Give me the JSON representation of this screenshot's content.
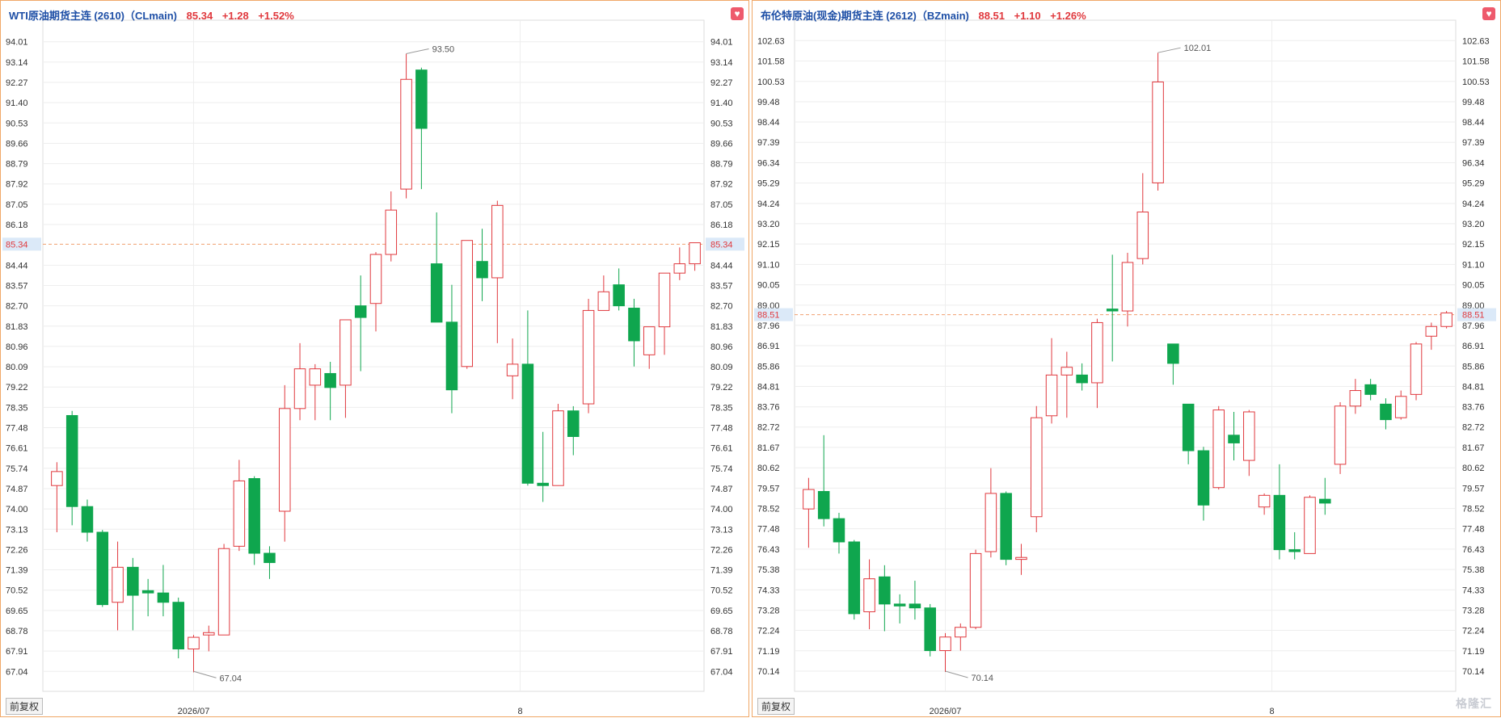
{
  "left": {
    "title": "WTI原油期货主连 (2610)（CLmain)",
    "price": "85.34",
    "change": "+1.28",
    "percent": "+1.52%",
    "adjust_button": "前复权"
  },
  "right": {
    "title": "布伦特原油(现金)期货主连 (2612)（BZmain)",
    "price": "88.51",
    "change": "+1.10",
    "percent": "+1.26%",
    "adjust_button": "前复权",
    "watermark": "格隆汇"
  },
  "colors": {
    "up": "#e0393e",
    "down": "#0fa64e",
    "accent": "#1e4fa6",
    "current_line": "#f0a070"
  },
  "chart_data": [
    {
      "type": "candlestick",
      "symbol": "CLmain",
      "y_ticks": [
        "94.01",
        "93.14",
        "92.27",
        "91.40",
        "90.53",
        "89.66",
        "88.79",
        "87.92",
        "87.05",
        "86.18",
        "85.34",
        "84.44",
        "83.57",
        "82.70",
        "81.83",
        "80.96",
        "80.09",
        "79.22",
        "78.35",
        "77.48",
        "76.61",
        "75.74",
        "74.87",
        "74.00",
        "73.13",
        "72.26",
        "71.39",
        "70.52",
        "69.65",
        "68.78",
        "67.91",
        "67.04"
      ],
      "ylim": [
        66.6,
        94.45
      ],
      "x_labels": [
        {
          "label": "2026/07",
          "index": 9
        },
        {
          "label": "8",
          "index": 30.5
        }
      ],
      "current": 85.34,
      "high_label": {
        "text": "93.50",
        "value": 93.5,
        "index": 23
      },
      "low_label": {
        "text": "67.04",
        "value": 67.04,
        "index": 9
      },
      "ohlc": [
        [
          75.0,
          76.0,
          73.0,
          75.6
        ],
        [
          78.0,
          78.2,
          73.3,
          74.1
        ],
        [
          74.1,
          74.4,
          72.6,
          73.0
        ],
        [
          73.0,
          73.1,
          69.8,
          69.9
        ],
        [
          70.0,
          72.6,
          68.8,
          71.5
        ],
        [
          71.5,
          71.9,
          68.8,
          70.3
        ],
        [
          70.5,
          71.0,
          69.4,
          70.4
        ],
        [
          70.4,
          71.6,
          69.4,
          70.0
        ],
        [
          70.0,
          70.2,
          67.6,
          68.0
        ],
        [
          68.0,
          68.6,
          67.0,
          68.5
        ],
        [
          68.6,
          69.0,
          67.9,
          68.7
        ],
        [
          68.6,
          72.5,
          68.6,
          72.3
        ],
        [
          72.4,
          76.1,
          72.2,
          75.2
        ],
        [
          75.3,
          75.4,
          71.6,
          72.1
        ],
        [
          72.1,
          72.4,
          71.0,
          71.7
        ],
        [
          73.9,
          79.3,
          72.6,
          78.3
        ],
        [
          78.3,
          81.1,
          77.8,
          80.0
        ],
        [
          79.3,
          80.2,
          77.8,
          80.0
        ],
        [
          79.8,
          80.3,
          77.8,
          79.2
        ],
        [
          79.3,
          82.1,
          77.9,
          82.1
        ],
        [
          82.7,
          84.0,
          79.9,
          82.2
        ],
        [
          82.8,
          85.0,
          81.6,
          84.9
        ],
        [
          84.9,
          87.6,
          84.6,
          86.8
        ],
        [
          87.7,
          93.5,
          87.3,
          92.4
        ],
        [
          92.8,
          92.9,
          87.7,
          90.3
        ],
        [
          84.5,
          86.7,
          82.1,
          82.0
        ],
        [
          82.0,
          83.6,
          78.1,
          79.1
        ],
        [
          80.1,
          85.5,
          80.0,
          85.5
        ],
        [
          84.6,
          86.0,
          82.9,
          83.9
        ],
        [
          83.9,
          87.2,
          81.1,
          87.0
        ],
        [
          79.7,
          81.3,
          78.7,
          80.2
        ],
        [
          80.2,
          82.5,
          75.0,
          75.1
        ],
        [
          75.1,
          77.3,
          74.3,
          75.0
        ],
        [
          75.0,
          78.5,
          75.0,
          78.2
        ],
        [
          78.2,
          78.4,
          76.3,
          77.1
        ],
        [
          78.5,
          83.0,
          78.1,
          82.5
        ],
        [
          82.5,
          84.0,
          82.5,
          83.3
        ],
        [
          83.6,
          84.3,
          82.5,
          82.7
        ],
        [
          82.6,
          83.0,
          80.1,
          81.2
        ],
        [
          80.6,
          81.8,
          80.0,
          81.8
        ],
        [
          81.8,
          84.1,
          80.6,
          84.1
        ],
        [
          84.1,
          85.2,
          83.8,
          84.5
        ],
        [
          84.5,
          85.4,
          84.2,
          85.4
        ]
      ]
    },
    {
      "type": "candlestick",
      "symbol": "BZmain",
      "y_ticks": [
        "102.63",
        "101.58",
        "100.53",
        "99.48",
        "98.44",
        "97.39",
        "96.34",
        "95.29",
        "94.24",
        "93.20",
        "92.15",
        "91.10",
        "90.05",
        "89.00",
        "88.51",
        "87.96",
        "86.91",
        "85.86",
        "84.81",
        "83.76",
        "82.72",
        "81.67",
        "80.62",
        "79.57",
        "78.52",
        "77.48",
        "76.43",
        "75.38",
        "74.33",
        "73.28",
        "72.24",
        "71.19",
        "70.14"
      ],
      "ylim": [
        69.6,
        103.1
      ],
      "x_labels": [
        {
          "label": "2026/07",
          "index": 9
        },
        {
          "label": "8",
          "index": 30.5
        }
      ],
      "current": 88.51,
      "high_label": {
        "text": "102.01",
        "value": 102.01,
        "index": 23
      },
      "low_label": {
        "text": "70.14",
        "value": 70.14,
        "index": 9
      },
      "ohlc": [
        [
          78.5,
          80.1,
          76.5,
          79.5
        ],
        [
          79.4,
          82.3,
          77.6,
          78.0
        ],
        [
          78.0,
          78.3,
          76.2,
          76.8
        ],
        [
          76.8,
          76.9,
          72.8,
          73.1
        ],
        [
          73.2,
          75.9,
          72.3,
          74.9
        ],
        [
          75.0,
          75.6,
          72.2,
          73.6
        ],
        [
          73.6,
          74.1,
          72.6,
          73.5
        ],
        [
          73.6,
          74.8,
          72.8,
          73.4
        ],
        [
          73.4,
          73.6,
          70.9,
          71.2
        ],
        [
          71.2,
          72.1,
          70.1,
          71.9
        ],
        [
          71.9,
          72.6,
          71.2,
          72.4
        ],
        [
          72.4,
          76.4,
          72.3,
          76.2
        ],
        [
          76.3,
          80.6,
          76.0,
          79.3
        ],
        [
          79.3,
          79.4,
          75.6,
          75.9
        ],
        [
          75.9,
          76.7,
          75.1,
          76.0
        ],
        [
          78.1,
          83.8,
          77.3,
          83.2
        ],
        [
          83.3,
          87.3,
          82.9,
          85.4
        ],
        [
          85.4,
          86.6,
          83.2,
          85.8
        ],
        [
          85.4,
          86.0,
          84.6,
          85.0
        ],
        [
          85.0,
          88.3,
          83.7,
          88.1
        ],
        [
          88.8,
          91.6,
          86.1,
          88.7
        ],
        [
          88.7,
          91.7,
          87.9,
          91.2
        ],
        [
          91.4,
          95.8,
          91.1,
          93.8
        ],
        [
          95.3,
          102.0,
          94.9,
          100.5
        ],
        [
          87.0,
          87.0,
          84.9,
          86.0
        ],
        [
          83.9,
          83.9,
          80.8,
          81.5
        ],
        [
          81.5,
          81.7,
          77.9,
          78.7
        ],
        [
          79.6,
          83.8,
          79.5,
          83.6
        ],
        [
          82.3,
          83.5,
          81.0,
          81.9
        ],
        [
          81.0,
          83.6,
          80.2,
          83.5
        ],
        [
          78.6,
          79.3,
          78.2,
          79.2
        ],
        [
          79.2,
          80.8,
          75.9,
          76.4
        ],
        [
          76.4,
          77.3,
          75.9,
          76.3
        ],
        [
          76.2,
          79.2,
          76.2,
          79.1
        ],
        [
          79.0,
          80.1,
          78.2,
          78.8
        ],
        [
          80.8,
          84.0,
          80.3,
          83.8
        ],
        [
          83.8,
          85.2,
          83.4,
          84.6
        ],
        [
          84.9,
          85.2,
          84.1,
          84.4
        ],
        [
          83.9,
          84.2,
          82.6,
          83.1
        ],
        [
          83.2,
          84.6,
          83.1,
          84.3
        ],
        [
          84.4,
          87.1,
          84.1,
          87.0
        ],
        [
          87.4,
          88.1,
          86.7,
          87.9
        ],
        [
          87.9,
          88.7,
          87.8,
          88.6
        ]
      ]
    }
  ]
}
